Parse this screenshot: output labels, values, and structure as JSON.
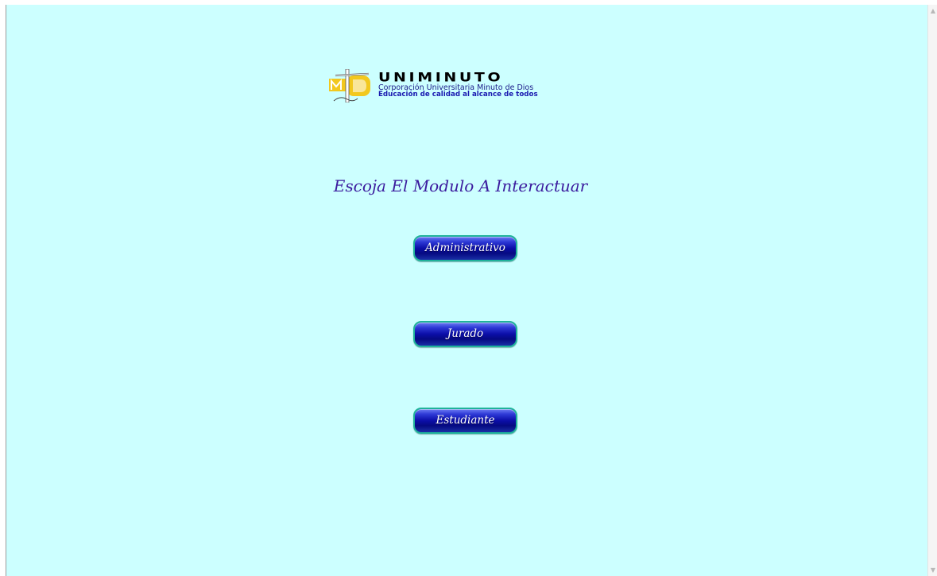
{
  "logo": {
    "wordmark": "UNIMINUTO",
    "line1": "Corporación Universitaria Minuto de Dios",
    "line2": "Educación de calidad al alcance de todos"
  },
  "heading": "Escoja El Modulo A Interactuar",
  "buttons": {
    "administrativo": "Administrativo",
    "jurado": "Jurado",
    "estudiante": "Estudiante"
  },
  "colors": {
    "page_background": "#ccffff",
    "heading_text": "#3b1b9e",
    "button_fill": "#0b0ea8",
    "button_border": "#1fb39a"
  }
}
